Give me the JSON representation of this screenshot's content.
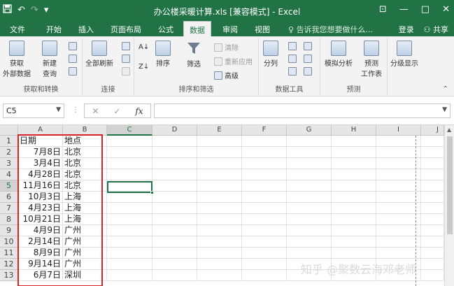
{
  "titlebar": {
    "title": "办公楼采暖计算.xls  [兼容模式] - Excel",
    "save_icon": "save-icon",
    "undo_icon": "↶",
    "redo_icon": "↷",
    "customize_icon": "▾",
    "restore_icon": "⊡",
    "minimize_icon": "—",
    "maximize_icon": "□",
    "close_icon": "✕"
  },
  "tabs": [
    "文件",
    "开始",
    "插入",
    "页面布局",
    "公式",
    "数据",
    "审阅",
    "视图"
  ],
  "active_tab": "数据",
  "tellme": "告诉我您想要做什么...",
  "login": "登录",
  "share": "共享",
  "ribbon": {
    "groups": [
      {
        "label": "获取和转换",
        "buttons": [
          "获取外部数据",
          "新建查询"
        ]
      },
      {
        "label": "连接",
        "buttons": [
          "全部刷新"
        ]
      },
      {
        "label": "排序和筛选",
        "buttons": [
          "排序",
          "筛选",
          "清除",
          "重新应用",
          "高级"
        ]
      },
      {
        "label": "数据工具",
        "buttons": [
          "分列"
        ]
      },
      {
        "label": "预测",
        "buttons": [
          "模拟分析",
          "预测工作表"
        ]
      },
      {
        "label": "",
        "buttons": [
          "分级显示"
        ]
      }
    ],
    "get_external_1": "获取",
    "get_external_2": "外部数据",
    "new_query_1": "新建",
    "new_query_2": "查询",
    "refresh_all": "全部刷新",
    "sort": "排序",
    "filter": "筛选",
    "clear": "清除",
    "reapply": "重新应用",
    "advanced": "高级",
    "split": "分列",
    "whatif": "模拟分析",
    "forecast_1": "预测",
    "forecast_2": "工作表",
    "outline": "分级显示",
    "group_get": "获取和转换",
    "group_conn": "连接",
    "group_sort": "排序和筛选",
    "group_tools": "数据工具",
    "group_forecast": "预测"
  },
  "formula_bar": {
    "name_box": "C5",
    "formula": "",
    "fx": "fx",
    "cancel": "✕",
    "enter": "✓"
  },
  "sheet": {
    "columns": [
      "A",
      "B",
      "C",
      "D",
      "E",
      "F",
      "G",
      "H",
      "I",
      "J"
    ],
    "active_cell": "C5",
    "rows": [
      {
        "n": "1",
        "a": "日期",
        "b": "地点"
      },
      {
        "n": "2",
        "a": "7月8日",
        "b": "北京"
      },
      {
        "n": "3",
        "a": "3月4日",
        "b": "北京"
      },
      {
        "n": "4",
        "a": "4月28日",
        "b": "北京"
      },
      {
        "n": "5",
        "a": "11月16日",
        "b": "北京"
      },
      {
        "n": "6",
        "a": "10月3日",
        "b": "上海"
      },
      {
        "n": "7",
        "a": "4月23日",
        "b": "上海"
      },
      {
        "n": "8",
        "a": "10月21日",
        "b": "上海"
      },
      {
        "n": "9",
        "a": "4月9日",
        "b": "广州"
      },
      {
        "n": "10",
        "a": "2月14日",
        "b": "广州"
      },
      {
        "n": "11",
        "a": "8月9日",
        "b": "广州"
      },
      {
        "n": "12",
        "a": "9月14日",
        "b": "广州"
      },
      {
        "n": "13",
        "a": "6月7日",
        "b": "深圳"
      }
    ]
  },
  "watermark": "知乎 @聚数云海邓老师",
  "colors": {
    "excel_green": "#217346",
    "highlight_red": "#d8232a"
  }
}
